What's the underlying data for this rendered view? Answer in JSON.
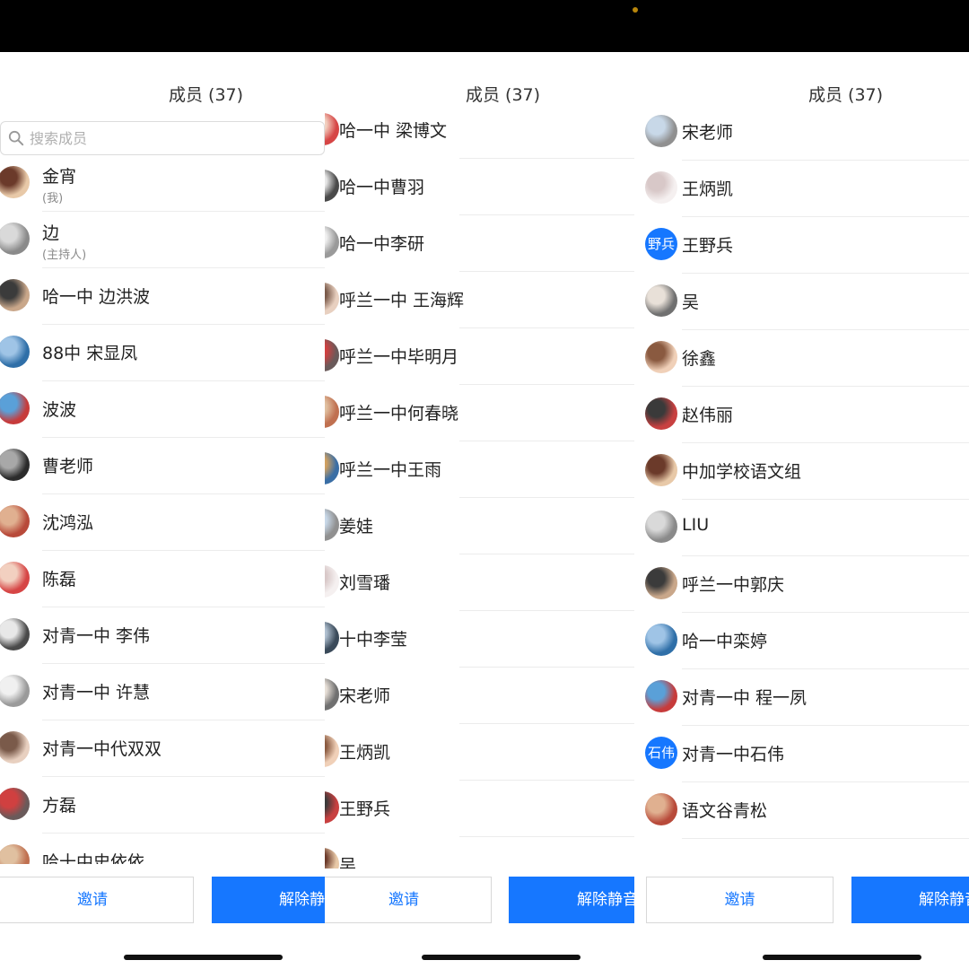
{
  "colors": {
    "accent": "#1677ff",
    "background": "#ffffff",
    "top_bar": "#000000"
  },
  "panels": [
    {
      "title": "成员 (37)",
      "search_placeholder": "搜索成员",
      "search_icon": "search-icon",
      "members": [
        {
          "name": "金宵",
          "sub": "(我)"
        },
        {
          "name": "边",
          "sub": "(主持人)"
        },
        {
          "name": "哈一中 边洪波"
        },
        {
          "name": "88中 宋显凤"
        },
        {
          "name": "波波"
        },
        {
          "name": "曹老师"
        },
        {
          "name": "沈鸿泓"
        },
        {
          "name": "陈磊"
        },
        {
          "name": "对青一中  李伟"
        },
        {
          "name": "对青一中  许慧"
        },
        {
          "name": "对青一中代双双"
        },
        {
          "name": "方磊"
        },
        {
          "name": "哈十中史依依"
        }
      ],
      "invite_label": "邀请",
      "unmute_label": "解除静音"
    },
    {
      "title": "成员 (37)",
      "members": [
        {
          "name": "哈一中 梁博文"
        },
        {
          "name": "哈一中曹羽"
        },
        {
          "name": "哈一中李研"
        },
        {
          "name": "呼兰一中 王海辉"
        },
        {
          "name": "呼兰一中毕明月"
        },
        {
          "name": "呼兰一中何春晓"
        },
        {
          "name": "呼兰一中王雨"
        },
        {
          "name": "姜娃"
        },
        {
          "name": "刘雪璠"
        },
        {
          "name": "十中李莹"
        },
        {
          "name": "宋老师"
        },
        {
          "name": "王炳凯"
        },
        {
          "name": "王野兵"
        },
        {
          "name": "吴"
        }
      ],
      "invite_label": "邀请",
      "unmute_label": "解除静音"
    },
    {
      "title": "成员 (37)",
      "members": [
        {
          "name": "宋老师"
        },
        {
          "name": "王炳凯"
        },
        {
          "name": "王野兵",
          "avatar_text": "野兵"
        },
        {
          "name": "吴"
        },
        {
          "name": "徐鑫"
        },
        {
          "name": "赵伟丽"
        },
        {
          "name": "中加学校语文组"
        },
        {
          "name": "LIU"
        },
        {
          "name": "呼兰一中郭庆"
        },
        {
          "name": "哈一中栾婷"
        },
        {
          "name": "对青一中  程一夙"
        },
        {
          "name": "对青一中石伟",
          "avatar_text": "石伟"
        },
        {
          "name": "语文谷青松"
        }
      ],
      "invite_label": "邀请",
      "unmute_label": "解除静音"
    }
  ]
}
